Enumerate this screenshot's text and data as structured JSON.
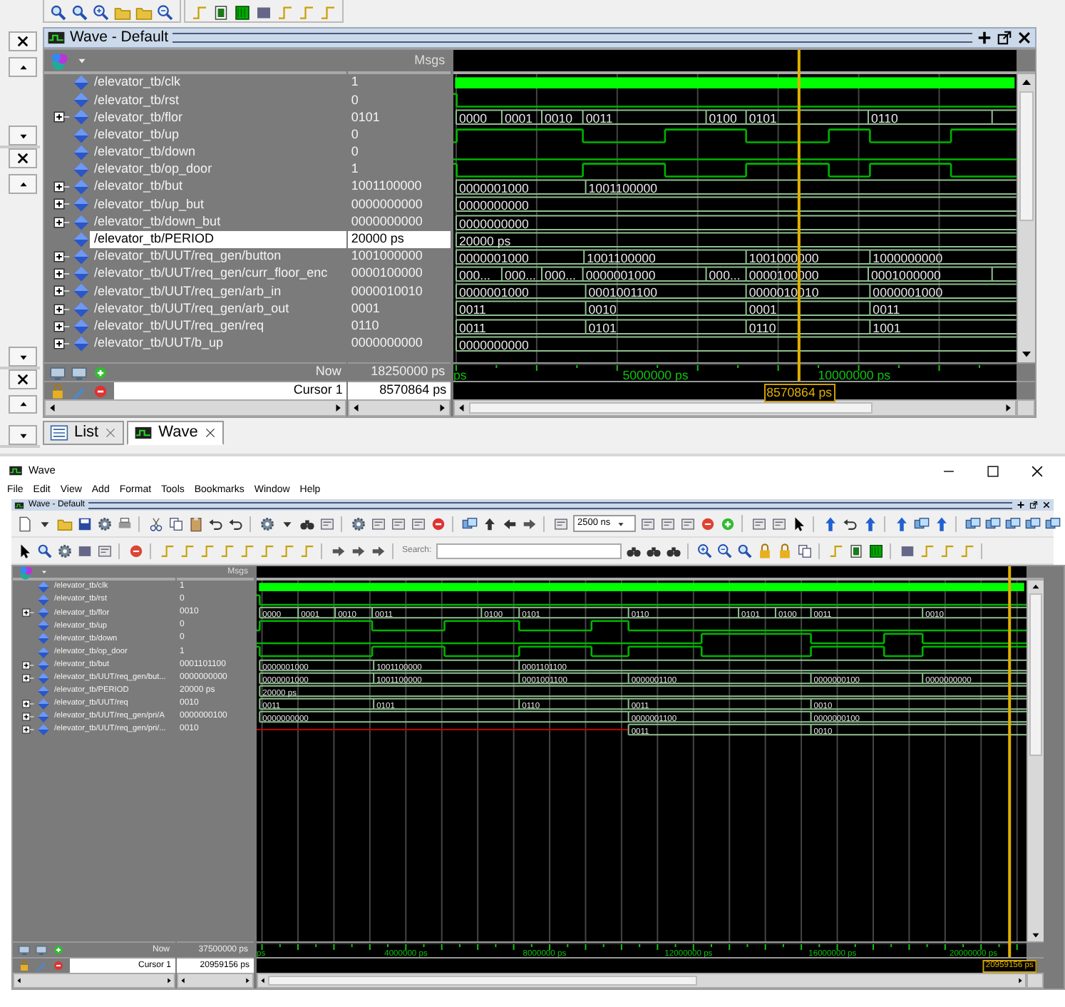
{
  "top_window": {
    "pane_title": "Wave - Default",
    "msgs_header": "Msgs",
    "signals": [
      {
        "name": "/elevator_tb/clk",
        "value": "1",
        "expandable": false,
        "selected": false,
        "wave": {
          "kind": "clock"
        }
      },
      {
        "name": "/elevator_tb/rst",
        "value": "0",
        "expandable": false,
        "selected": false,
        "wave": {
          "kind": "bit"
        }
      },
      {
        "name": "/elevator_tb/flor",
        "value": "0101",
        "expandable": true,
        "selected": false,
        "wave": {
          "kind": "bus",
          "segments": [
            "0000",
            "0001",
            "0010",
            "0011",
            "0100",
            "0101",
            "0110"
          ]
        }
      },
      {
        "name": "/elevator_tb/up",
        "value": "0",
        "expandable": false,
        "selected": false,
        "wave": {
          "kind": "bit"
        }
      },
      {
        "name": "/elevator_tb/down",
        "value": "0",
        "expandable": false,
        "selected": false,
        "wave": {
          "kind": "bit"
        }
      },
      {
        "name": "/elevator_tb/op_door",
        "value": "1",
        "expandable": false,
        "selected": false,
        "wave": {
          "kind": "bit"
        }
      },
      {
        "name": "/elevator_tb/but",
        "value": "1001100000",
        "expandable": true,
        "selected": false,
        "wave": {
          "kind": "bus",
          "segments": [
            "0000001000",
            "1001100000"
          ]
        }
      },
      {
        "name": "/elevator_tb/up_but",
        "value": "0000000000",
        "expandable": true,
        "selected": false,
        "wave": {
          "kind": "bus",
          "segments": [
            "0000000000"
          ]
        }
      },
      {
        "name": "/elevator_tb/down_but",
        "value": "0000000000",
        "expandable": true,
        "selected": false,
        "wave": {
          "kind": "bus",
          "segments": [
            "0000000000"
          ]
        }
      },
      {
        "name": "/elevator_tb/PERIOD",
        "value": "20000 ps",
        "expandable": false,
        "selected": true,
        "wave": {
          "kind": "bus",
          "segments": [
            "20000 ps"
          ]
        }
      },
      {
        "name": "/elevator_tb/UUT/req_gen/button",
        "value": "1001000000",
        "expandable": true,
        "selected": false,
        "wave": {
          "kind": "bus",
          "segments": [
            "0000001000",
            "1001100000",
            "1001000000",
            "1000000000"
          ]
        }
      },
      {
        "name": "/elevator_tb/UUT/req_gen/curr_floor_enc",
        "value": "0000100000",
        "expandable": true,
        "selected": false,
        "wave": {
          "kind": "bus",
          "segments": [
            "000...",
            "000...",
            "000...",
            "0000001000",
            "000...",
            "0000100000",
            "0001000000"
          ]
        }
      },
      {
        "name": "/elevator_tb/UUT/req_gen/arb_in",
        "value": "0000010010",
        "expandable": true,
        "selected": false,
        "wave": {
          "kind": "bus",
          "segments": [
            "0000001000",
            "0001001100",
            "0000010010",
            "0000001000"
          ]
        }
      },
      {
        "name": "/elevator_tb/UUT/req_gen/arb_out",
        "value": "0001",
        "expandable": true,
        "selected": false,
        "wave": {
          "kind": "bus",
          "segments": [
            "0011",
            "0010",
            "0001",
            "0011"
          ]
        }
      },
      {
        "name": "/elevator_tb/UUT/req_gen/req",
        "value": "0110",
        "expandable": true,
        "selected": false,
        "wave": {
          "kind": "bus",
          "segments": [
            "0011",
            "0101",
            "0110",
            "1001"
          ]
        }
      },
      {
        "name": "/elevator_tb/UUT/b_up",
        "value": "0000000000",
        "expandable": true,
        "selected": false,
        "wave": {
          "kind": "bus",
          "segments": [
            "0000000000"
          ]
        }
      }
    ],
    "now": {
      "label": "Now",
      "value": "18250000 ps"
    },
    "cursor": {
      "label": "Cursor 1",
      "value": "8570864 ps",
      "time_label": "8570864 ps"
    },
    "axis": [
      "ps",
      "5000000 ps",
      "10000000 ps"
    ],
    "tabs": [
      {
        "label": "List",
        "selected": false
      },
      {
        "label": "Wave",
        "selected": true
      }
    ]
  },
  "wave_window": {
    "title": "Wave",
    "menu": [
      "File",
      "Edit",
      "View",
      "Add",
      "Format",
      "Tools",
      "Bookmarks",
      "Window",
      "Help"
    ],
    "pane_title": "Wave - Default",
    "time_step": "2500 ns",
    "search_label": "Search:",
    "msgs_header": "Msgs",
    "signals": [
      {
        "name": "/elevator_tb/clk",
        "value": "1",
        "expandable": false,
        "selected": false,
        "wave": {
          "kind": "clock"
        }
      },
      {
        "name": "/elevator_tb/rst",
        "value": "0",
        "expandable": false,
        "selected": false,
        "wave": {
          "kind": "bit"
        }
      },
      {
        "name": "/elevator_tb/flor",
        "value": "0010",
        "expandable": true,
        "selected": false,
        "wave": {
          "kind": "bus",
          "segments": [
            "0000",
            "0001",
            "0010",
            "0011",
            "0100",
            "0101",
            "0110",
            "0101",
            "0100",
            "0011",
            "0010"
          ]
        }
      },
      {
        "name": "/elevator_tb/up",
        "value": "0",
        "expandable": false,
        "selected": false,
        "wave": {
          "kind": "bit"
        }
      },
      {
        "name": "/elevator_tb/down",
        "value": "0",
        "expandable": false,
        "selected": false,
        "wave": {
          "kind": "bit"
        }
      },
      {
        "name": "/elevator_tb/op_door",
        "value": "1",
        "expandable": false,
        "selected": false,
        "wave": {
          "kind": "bit"
        }
      },
      {
        "name": "/elevator_tb/but",
        "value": "0001101100",
        "expandable": true,
        "selected": false,
        "wave": {
          "kind": "bus",
          "segments": [
            "0000001000",
            "1001100000",
            "0001101100"
          ]
        }
      },
      {
        "name": "/elevator_tb/UUT/req_gen/but...",
        "value": "0000000000",
        "expandable": true,
        "selected": false,
        "wave": {
          "kind": "bus",
          "segments": [
            "0000001000",
            "1001100000",
            "0001001100",
            "0000001100",
            "0000000100",
            "0000000000"
          ]
        }
      },
      {
        "name": "/elevator_tb/PERIOD",
        "value": "20000 ps",
        "expandable": false,
        "selected": false,
        "wave": {
          "kind": "bus",
          "segments": [
            "20000 ps"
          ]
        }
      },
      {
        "name": "/elevator_tb/UUT/req",
        "value": "0010",
        "expandable": true,
        "selected": false,
        "wave": {
          "kind": "bus",
          "segments": [
            "0011",
            "0101",
            "0110",
            "0011",
            "0010"
          ]
        }
      },
      {
        "name": "/elevator_tb/UUT/req_gen/pri/A",
        "value": "0000000100",
        "expandable": true,
        "selected": false,
        "wave": {
          "kind": "bus",
          "segments": [
            "0000000000",
            "0000001100",
            "0000000100"
          ]
        }
      },
      {
        "name": "/elevator_tb/UUT/req_gen/pri/...",
        "value": "0010",
        "expandable": true,
        "selected": false,
        "wave": {
          "kind": "bus",
          "segments": [
            "0011",
            "0010"
          ]
        }
      }
    ],
    "now": {
      "label": "Now",
      "value": "37500000 ps"
    },
    "cursor": {
      "label": "Cursor 1",
      "value": "20959156 ps",
      "time_label": "20959156 ps"
    },
    "axis": [
      "ps",
      "4000000 ps",
      "8000000 ps",
      "12000000 ps",
      "16000000 ps",
      "20000000 ps"
    ]
  }
}
